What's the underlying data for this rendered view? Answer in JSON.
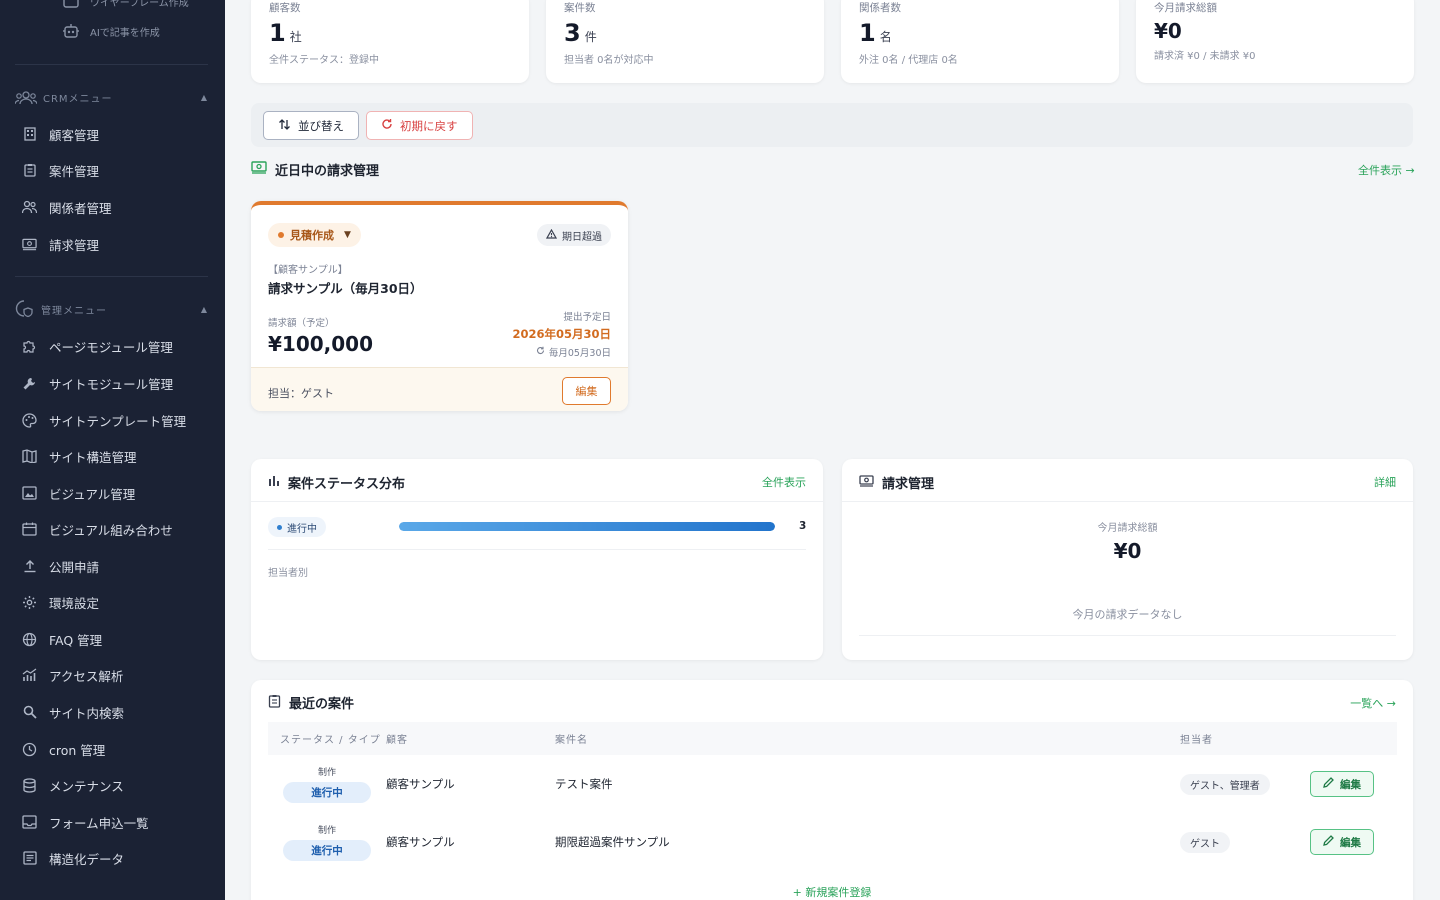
{
  "sidebar": {
    "top_items": [
      {
        "label": "ワイヤーフレーム作成",
        "icon": "layout-icon"
      },
      {
        "label": "AIで記事を作成",
        "icon": "robot-icon"
      }
    ],
    "crm_section": "CRMメニュー",
    "crm_items": [
      "顧客管理",
      "案件管理",
      "関係者管理",
      "請求管理"
    ],
    "admin_section": "管理メニュー",
    "admin_items": [
      "ページモジュール管理",
      "サイトモジュール管理",
      "サイトテンプレート管理",
      "サイト構造管理",
      "ビジュアル管理",
      "ビジュアル組み合わせ",
      "公開申請",
      "環境設定",
      "FAQ 管理",
      "アクセス解析",
      "サイト内検索",
      "cron 管理",
      "メンテナンス",
      "フォーム申込一覧",
      "構造化データ"
    ]
  },
  "stats": [
    {
      "label": "顧客数",
      "value": "1",
      "unit": "社",
      "sub": "全件ステータス：登録中"
    },
    {
      "label": "案件数",
      "value": "3",
      "unit": "件",
      "sub": "担当者 0名が対応中"
    },
    {
      "label": "関係者数",
      "value": "1",
      "unit": "名",
      "sub": "外注 0名 / 代理店 0名"
    },
    {
      "label": "今月請求総額",
      "value": "¥0",
      "unit": "",
      "sub": "請求済 ¥0 / 未請求 ¥0"
    }
  ],
  "toolbar": {
    "sort_label": "並び替え",
    "reset_label": "初期に戻す"
  },
  "invoices_section": {
    "title": "近日中の請求管理",
    "view_all": "全件表示 →",
    "card": {
      "status": "見積作成",
      "overdue": "期日超過",
      "client": "【顧客サンプル】",
      "title": "請求サンプル（毎月30日）",
      "amount_label": "請求額（予定）",
      "amount": "¥100,000",
      "due_label": "提出予定日",
      "due_date": "2026年05月30日",
      "repeat": "毎月05月30日",
      "owner": "担当：ゲスト",
      "edit": "編集"
    }
  },
  "status_panel": {
    "title": "案件ステータス分布",
    "link": "全件表示",
    "status_label": "進行中",
    "count": "3",
    "progress": 1.0,
    "by_owner": "担当者別"
  },
  "billing_panel": {
    "title": "請求管理",
    "link": "詳細",
    "total_label": "今月請求総額",
    "total": "¥0",
    "empty": "今月の請求データなし"
  },
  "recent_cases": {
    "title": "最近の案件",
    "link": "一覧へ →",
    "columns": [
      "ステータス / タイプ",
      "顧客",
      "案件名",
      "担当者"
    ],
    "rows": [
      {
        "type": "制作",
        "status": "進行中",
        "client": "顧客サンプル",
        "name": "テスト案件",
        "owner": "ゲスト、管理者",
        "edit": "編集"
      },
      {
        "type": "制作",
        "status": "進行中",
        "client": "顧客サンプル",
        "name": "期限超過案件サンプル",
        "owner": "ゲスト",
        "edit": "編集"
      }
    ],
    "new_link": "+ 新規案件登録"
  },
  "colors": {
    "sidebar_bg": "#1b2234",
    "accent_orange": "#e07a2e",
    "accent_green": "#2aa35a",
    "accent_blue": "#2274cc"
  }
}
